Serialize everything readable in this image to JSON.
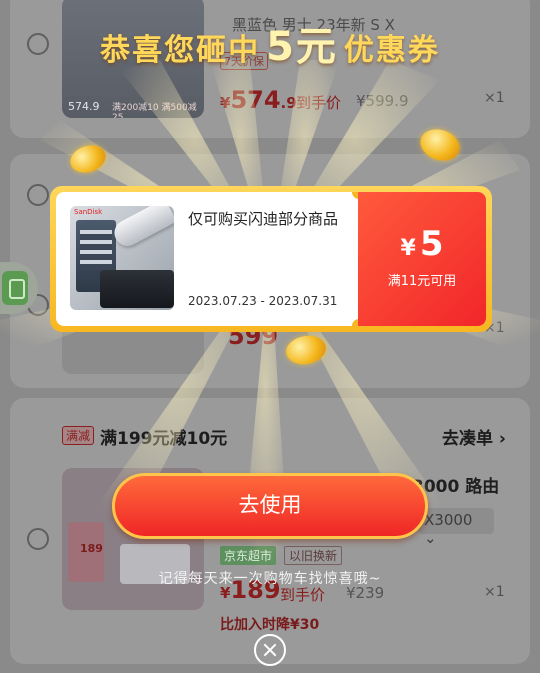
{
  "popup": {
    "headline_prefix": "恭喜您砸中",
    "headline_amount": "5元",
    "headline_suffix": "优惠券",
    "coupon": {
      "description": "仅可购买闪迪部分商品",
      "validity": "2023.07.23 - 2023.07.31",
      "currency": "¥",
      "value": "5",
      "condition": "满11元可用",
      "product_brand_text": "SanDisk"
    },
    "use_button": "去使用",
    "reminder": "记得每天来一次购物车找惊喜哦~",
    "close_icon": "close-icon"
  },
  "cart": {
    "items": [
      {
        "title_partial": "黑蓝色 男士 23年新 S X",
        "tag": "7天价保",
        "price_prefix": "¥",
        "price_main": "574",
        "price_decimal": ".9",
        "price_label": "到手价",
        "original_price": "¥599.9",
        "quantity": "×1",
        "thumb_price": "574.9",
        "thumb_coupon": "满200减10 满500减25"
      },
      {
        "price_partial": "599",
        "quantity": "×1"
      },
      {
        "price_prefix": "¥",
        "price_main": "189",
        "price_label": "到手价",
        "original_price": "¥239",
        "quantity": "×1",
        "jd_tag": "京东超市",
        "old_tag": "以旧换新",
        "spec": "X3000",
        "title_partial": "3000 路由",
        "drop_text": "比加入时降¥30"
      }
    ],
    "group_tag": "满减",
    "group_title": "满199元减10元",
    "group_link": "去凑单 ›"
  },
  "colors": {
    "accent_red": "#ef2626",
    "gold": "#ffd75a",
    "coupon_red": "#f2262a"
  }
}
